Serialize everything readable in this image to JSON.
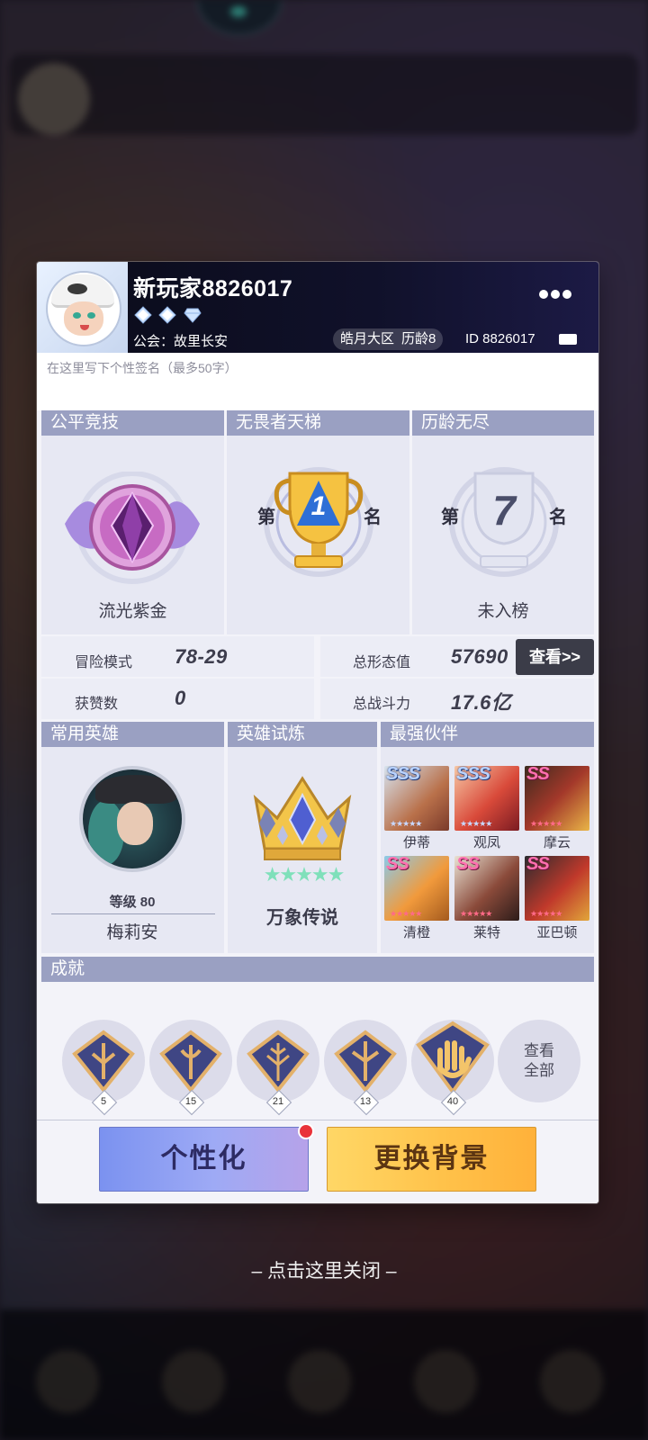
{
  "profile": {
    "username": "新玩家8826017",
    "guild": "公会：故里长安",
    "server": "皓月大区",
    "tenure": "历龄8",
    "player_id": "ID 8826017",
    "signature_placeholder": "在这里写下个性签名（最多50字）"
  },
  "ranks": [
    {
      "title": "公平竞技",
      "label": "流光紫金"
    },
    {
      "title": "无畏者天梯",
      "prefix": "第",
      "number": "1",
      "suffix": "名"
    },
    {
      "title": "历龄无尽",
      "prefix": "第",
      "number": "7",
      "suffix": "名",
      "label": "未入榜"
    }
  ],
  "stats": {
    "adventure_label": "冒险模式",
    "adventure_value": "78-29",
    "form_label": "总形态值",
    "form_value": "57690",
    "likes_label": "获赞数",
    "likes_value": "0",
    "power_label": "总战斗力",
    "power_value": "17.6亿",
    "view_button": "查看>>"
  },
  "sections": {
    "common_hero": "常用英雄",
    "hero_trial": "英雄试炼",
    "strongest_partners": "最强伙伴",
    "achievements": "成就"
  },
  "hero": {
    "level": "等级 80",
    "name": "梅莉安"
  },
  "trial": {
    "title": "万象传说",
    "stars": "★★★★★"
  },
  "partners": [
    {
      "grade": "SSS",
      "name": "伊蒂"
    },
    {
      "grade": "SSS",
      "name": "观凤"
    },
    {
      "grade": "SS",
      "name": "摩云"
    },
    {
      "grade": "SS",
      "name": "清橙"
    },
    {
      "grade": "SS",
      "name": "莱特"
    },
    {
      "grade": "SS",
      "name": "亚巴顿"
    }
  ],
  "achievements": [
    {
      "count": "5"
    },
    {
      "count": "15"
    },
    {
      "count": "21"
    },
    {
      "count": "13"
    },
    {
      "count": "40"
    }
  ],
  "view_all": {
    "line1": "查看",
    "line2": "全部"
  },
  "buttons": {
    "customize": "个性化",
    "change_background": "更换背景"
  },
  "close_hint": "– 点击这里关闭 –",
  "colors": {
    "section_header": "#9aa0c2",
    "accent_purple": "#7b92f0",
    "accent_gold": "#ffc24a"
  }
}
